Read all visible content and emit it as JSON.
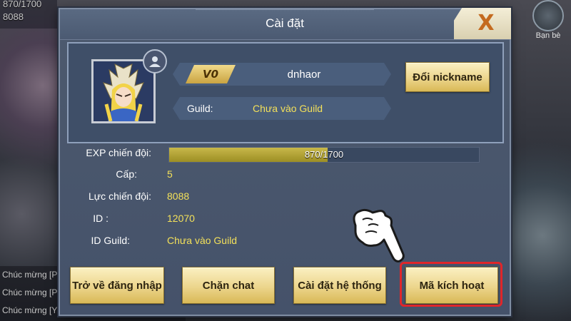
{
  "background": {
    "top_left_counter": "870/1700",
    "top_left_power": "8088",
    "chat_lines": [
      "Chúc mừng [Pi",
      "Chúc mừng [Pi",
      "Chúc mừng [YUG"
    ],
    "right_icon_label": "Bạn bè"
  },
  "dialog": {
    "title": "Cài đặt",
    "close_glyph": "X"
  },
  "profile": {
    "vip_label": "V0",
    "nickname": "dnhaor",
    "rename_button": "Đổi nickname",
    "guild_label": "Guild:",
    "guild_value": "Chưa vào Guild"
  },
  "stats": {
    "exp_label": "EXP chiến đội:",
    "exp_text": "870/1700",
    "exp_current": 870,
    "exp_max": 1700,
    "level_label": "Cấp:",
    "level_value": "5",
    "power_label": "Lực chiến đội:",
    "power_value": "8088",
    "id_label": "ID :",
    "id_value": "12070",
    "guild_id_label": "ID Guild:",
    "guild_id_value": "Chưa vào Guild"
  },
  "buttons": {
    "logout": "Trở về đăng nhập",
    "block_chat": "Chặn chat",
    "system_settings": "Cài đặt hệ thống",
    "activation_code": "Mã kích hoạt"
  },
  "colors": {
    "highlight": "#e0262a",
    "value_text": "#f3e05a",
    "close_icon": "#c46a1e"
  }
}
